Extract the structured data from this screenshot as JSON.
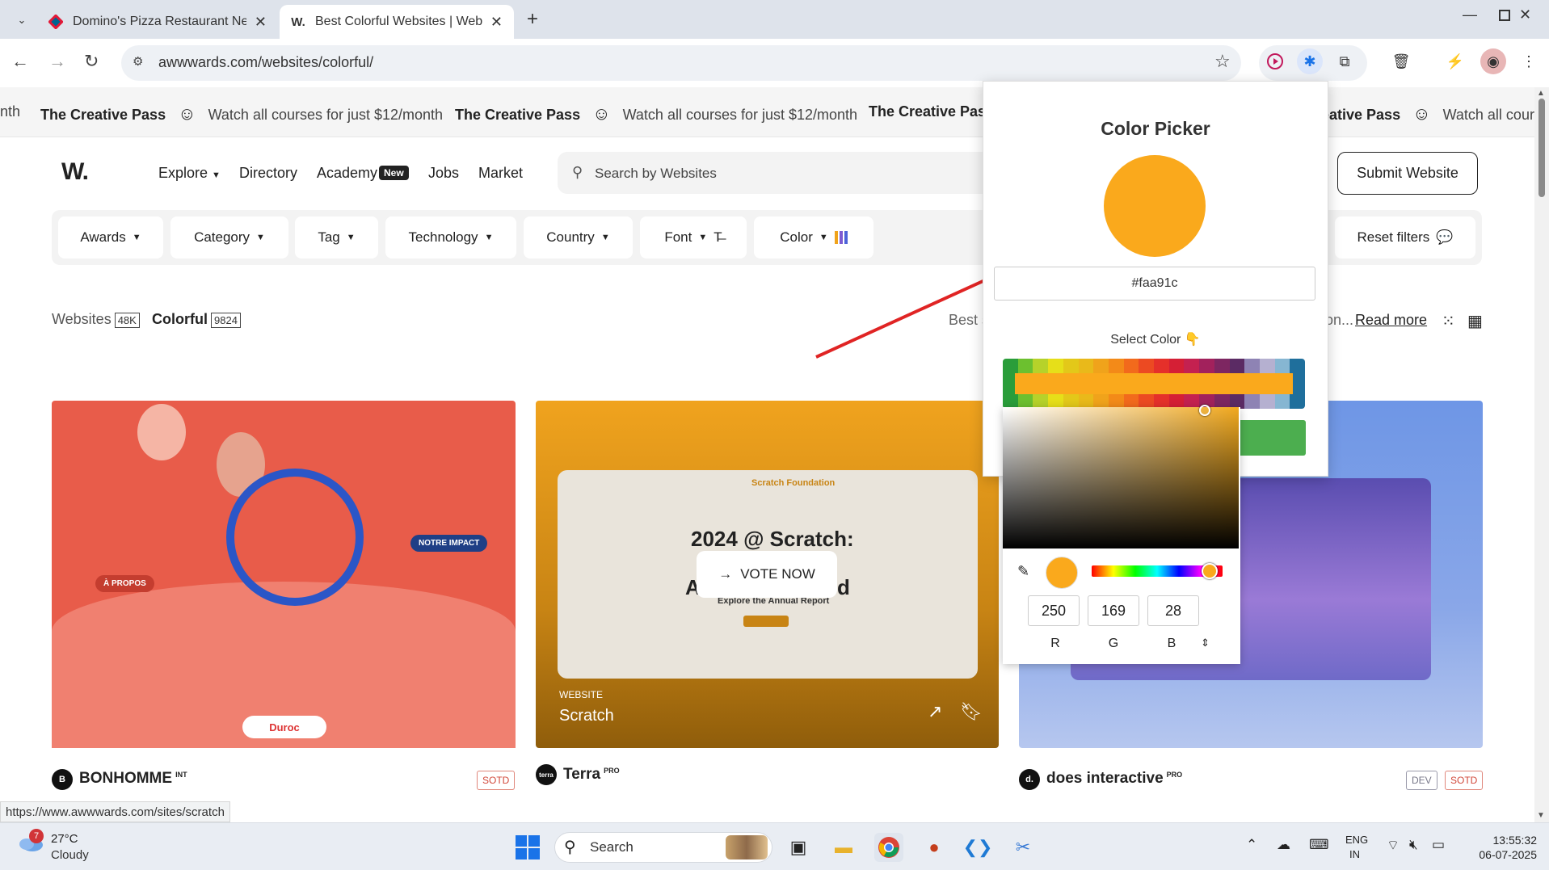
{
  "browser": {
    "tabs": [
      {
        "title": "Domino's Pizza Restaurant Nea",
        "favicon": "dominos-icon"
      },
      {
        "title": "Best Colorful Websites | Web D",
        "favicon": "W."
      }
    ],
    "url": "awwwards.com/websites/colorful/",
    "status_url": "https://www.awwwards.com/sites/scratch"
  },
  "banner": {
    "items": [
      {
        "lead": "nth",
        "text": ""
      },
      {
        "lead": "The Creative Pass",
        "text": "Watch all courses for just $12/month"
      },
      {
        "lead": "The Creative Pass",
        "text": "Watch all courses for just $12/month"
      },
      {
        "lead": "The Creative Pass",
        "text": ""
      },
      {
        "lead": "eative Pass",
        "text": "Watch all cour"
      }
    ]
  },
  "site": {
    "logo": "W.",
    "nav": [
      "Explore",
      "Directory",
      "Academy",
      "Jobs",
      "Market"
    ],
    "academy_badge": "New",
    "search_placeholder": "Search by Websites",
    "submit_label": "Submit Website",
    "filters": [
      "Awards",
      "Category",
      "Tag",
      "Technology",
      "Country",
      "Font",
      "Color"
    ],
    "reset_label": "Reset filters",
    "crumb_websites": "Websites",
    "crumb_websites_count": "48K",
    "crumb_colorful": "Colorful",
    "crumb_colorful_count": "9824",
    "best_text": "Best s",
    "desc_tail": "on...",
    "read_more": "Read more"
  },
  "cards": [
    {
      "name": "BONHOMME",
      "sup": "INT",
      "logo": "B",
      "badges": [
        "SOTD"
      ],
      "tag1": "À PROPOS",
      "tag2": "NOTRE IMPACT",
      "pill": "Duroc"
    },
    {
      "name": "Terra",
      "sup": "PRO",
      "logo": "terra",
      "badges": [],
      "label": "WEBSITE",
      "site": "Scratch",
      "vote": "VOTE NOW",
      "head1": "2024 @ Scratch:",
      "head2": "A",
      "head2b": "d",
      "sub": "Explore the Annual Report",
      "brand": "Scratch Foundation"
    },
    {
      "name": "does interactive",
      "sup": "PRO",
      "logo": "d.",
      "badges": [
        "DEV",
        "SOTD"
      ]
    }
  ],
  "picker": {
    "title": "Color Picker",
    "hex": "#faa91c",
    "select_label": "Select Color 👇",
    "r": "250",
    "g": "169",
    "b": "28",
    "r_label": "R",
    "g_label": "G",
    "b_label": "B",
    "selected_color": "#faa91c",
    "palette": [
      "#2a9d3a",
      "#6cc02f",
      "#b6d22a",
      "#e6df19",
      "#e3c819",
      "#e9b91a",
      "#f0a31b",
      "#f38a18",
      "#f26a1c",
      "#ec4a22",
      "#e5302a",
      "#d51f35",
      "#c42150",
      "#a2215c",
      "#7d2661",
      "#5b2b64",
      "#8e83b4",
      "#b5b0d0",
      "#86b6d2",
      "#1f6f9c"
    ]
  },
  "taskbar": {
    "weather_temp": "27°C",
    "weather_cond": "Cloudy",
    "weather_badge": "7",
    "search": "Search",
    "lang1": "ENG",
    "lang2": "IN",
    "time": "13:55:32",
    "date": "06-07-2025"
  }
}
